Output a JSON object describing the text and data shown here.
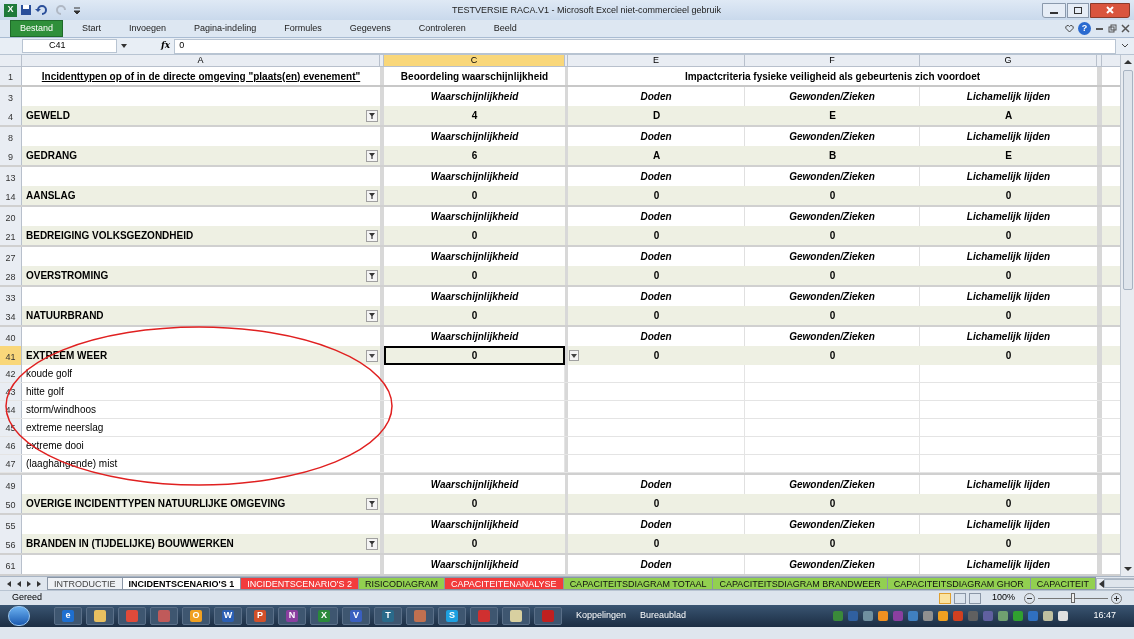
{
  "window": {
    "title": "TESTVERSIE RACA.V1  -  Microsoft Excel niet-commercieel gebruik",
    "app_letter": "X"
  },
  "ribbon_tabs": [
    {
      "label": "Bestand",
      "selected": true
    },
    {
      "label": "Start",
      "selected": false
    },
    {
      "label": "Invoegen",
      "selected": false
    },
    {
      "label": "Pagina-indeling",
      "selected": false
    },
    {
      "label": "Formules",
      "selected": false
    },
    {
      "label": "Gegevens",
      "selected": false
    },
    {
      "label": "Controleren",
      "selected": false
    },
    {
      "label": "Beeld",
      "selected": false
    }
  ],
  "help_label": "?",
  "formula_bar": {
    "name_box": "C41",
    "fx_label": "fx",
    "value": "0"
  },
  "columns": [
    {
      "label": "A",
      "selected": false
    },
    {
      "label": "C",
      "selected": true
    },
    {
      "label": "E",
      "selected": false
    },
    {
      "label": "F",
      "selected": false
    },
    {
      "label": "G",
      "selected": false
    }
  ],
  "header_row": {
    "row": "1",
    "col_a": "Incidenttypen op of in de directe omgeving \"plaats(en) evenement\"",
    "col_c": "Beoordeling waarschijnlijkheid",
    "col_efg": "Impactcriteria fysieke veiligheid als gebeurtenis zich voordoet"
  },
  "groups": [
    {
      "label_row": "3",
      "value_row": "4",
      "labels": [
        "Waarschijnlijkheid",
        "Doden",
        "Gewonden/Zieken",
        "Lichamelijk lijden"
      ],
      "name": "GEWELD",
      "kind": "filtered",
      "values": [
        "4",
        "D",
        "E",
        "A"
      ],
      "selected": false
    },
    {
      "label_row": "8",
      "value_row": "9",
      "labels": [
        "Waarschijnlijkheid",
        "Doden",
        "Gewonden/Zieken",
        "Lichamelijk lijden"
      ],
      "name": "GEDRANG",
      "kind": "filtered",
      "values": [
        "6",
        "A",
        "B",
        "E"
      ],
      "selected": false
    },
    {
      "label_row": "13",
      "value_row": "14",
      "labels": [
        "Waarschijnlijkheid",
        "Doden",
        "Gewonden/Zieken",
        "Lichamelijk lijden"
      ],
      "name": "AANSLAG",
      "kind": "filtered",
      "values": [
        "0",
        "0",
        "0",
        "0"
      ],
      "selected": false
    },
    {
      "label_row": "20",
      "value_row": "21",
      "labels": [
        "Waarschijnlijkheid",
        "Doden",
        "Gewonden/Zieken",
        "Lichamelijk lijden"
      ],
      "name": "BEDREIGING VOLKSGEZONDHEID",
      "kind": "filtered",
      "values": [
        "0",
        "0",
        "0",
        "0"
      ],
      "selected": false
    },
    {
      "label_row": "27",
      "value_row": "28",
      "labels": [
        "Waarschijnlijkheid",
        "Doden",
        "Gewonden/Zieken",
        "Lichamelijk lijden"
      ],
      "name": "OVERSTROMING",
      "kind": "filtered",
      "values": [
        "0",
        "0",
        "0",
        "0"
      ],
      "selected": false
    },
    {
      "label_row": "33",
      "value_row": "34",
      "labels": [
        "Waarschijnlijkheid",
        "Doden",
        "Gewonden/Zieken",
        "Lichamelijk lijden"
      ],
      "name": "NATUURBRAND",
      "kind": "filtered",
      "values": [
        "0",
        "0",
        "0",
        "0"
      ],
      "selected": false
    },
    {
      "label_row": "40",
      "value_row": "41",
      "labels": [
        "Waarschijnlijkheid",
        "Doden",
        "Gewonden/Zieken",
        "Lichamelijk lijden"
      ],
      "name": "EXTREEM WEER",
      "kind": "dropdown",
      "values": [
        "0",
        "0",
        "0",
        "0"
      ],
      "selected": true,
      "children": [
        {
          "row": "42",
          "text": "koude golf"
        },
        {
          "row": "43",
          "text": "hitte golf"
        },
        {
          "row": "44",
          "text": "storm/windhoos"
        },
        {
          "row": "45",
          "text": "extreme neerslag"
        },
        {
          "row": "46",
          "text": "extreme dooi"
        },
        {
          "row": "47",
          "text": "(laaghangende) mist"
        }
      ]
    },
    {
      "label_row": "49",
      "value_row": "50",
      "labels": [
        "Waarschijnlijkheid",
        "Doden",
        "Gewonden/Zieken",
        "Lichamelijk lijden"
      ],
      "name": "OVERIGE INCIDENTTYPEN NATUURLIJKE OMGEVING",
      "kind": "filtered",
      "values": [
        "0",
        "0",
        "0",
        "0"
      ],
      "selected": false
    },
    {
      "label_row": "55",
      "value_row": "56",
      "labels": [
        "Waarschijnlijkheid",
        "Doden",
        "Gewonden/Zieken",
        "Lichamelijk lijden"
      ],
      "name": "BRANDEN IN (TIJDELIJKE) BOUWWERKEN",
      "kind": "filtered",
      "values": [
        "0",
        "0",
        "0",
        "0"
      ],
      "selected": false
    },
    {
      "label_row": "61",
      "labels": [
        "Waarschijnlijkheid",
        "Doden",
        "Gewonden/Zieken",
        "Lichamelijk lijden"
      ]
    }
  ],
  "sheet_tabs": [
    {
      "label": "INTRODUCTIE",
      "selected": false
    },
    {
      "label": "INCIDENTSCENARIO'S 1",
      "selected": true
    },
    {
      "label": "INCIDENTSCENARIO'S 2",
      "selected": false,
      "color": "#f23c3c"
    },
    {
      "label": "RISICODIAGRAM",
      "selected": false,
      "color": "#92d050"
    },
    {
      "label": "CAPACITEITENANALYSE",
      "selected": false,
      "color": "#f23c3c"
    },
    {
      "label": "CAPACITEITSDIAGRAM TOTAAL",
      "selected": false,
      "color": "#92d050"
    },
    {
      "label": "CAPACITEITSDIAGRAM BRANDWEER",
      "selected": false,
      "color": "#92d050"
    },
    {
      "label": "CAPACITEITSDIAGRAM GHOR",
      "selected": false,
      "color": "#92d050"
    },
    {
      "label": "CAPACITEIT",
      "selected": false,
      "color": "#92d050"
    }
  ],
  "status_bar": {
    "text": "Gereed",
    "zoom": "100%",
    "zoom_slider": {
      "level": 0.5
    }
  },
  "taskbar": {
    "apps": [
      {
        "glyph": "e",
        "color": "#1e6fd0"
      },
      {
        "color": "#e8c060"
      },
      {
        "color": "#e04a3a"
      },
      {
        "color": "#c05a5a"
      },
      {
        "glyph": "O",
        "color": "#f0a020"
      },
      {
        "glyph": "W",
        "color": "#2b5fb4"
      },
      {
        "glyph": "P",
        "color": "#d2502a"
      },
      {
        "glyph": "N",
        "color": "#8a3fa0"
      },
      {
        "glyph": "X",
        "color": "#2a8a3a"
      },
      {
        "glyph": "V",
        "color": "#3a5fc0"
      },
      {
        "glyph": "T",
        "color": "#2a6a8a"
      },
      {
        "color": "#c07050"
      },
      {
        "glyph": "S",
        "color": "#1ea0e0"
      },
      {
        "color": "#d03030"
      },
      {
        "color": "#d8d0a0"
      },
      {
        "color": "#c02020"
      }
    ],
    "links": [
      "Koppelingen",
      "Bureaublad"
    ],
    "clock": "16:47"
  }
}
